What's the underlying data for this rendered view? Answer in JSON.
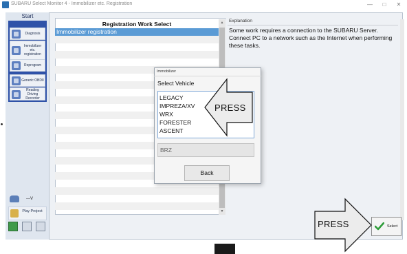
{
  "window": {
    "title": "SUBARU Select Monitor 4 - Immobilizer etc. Registration",
    "minimize": "—",
    "maximize": "□",
    "close": "✕"
  },
  "sidebar": {
    "start": "Start",
    "items": [
      {
        "label": "Diagnosis",
        "icon": "diagnosis-icon"
      },
      {
        "label": "Immobilizer etc. registration",
        "icon": "immobilizer-icon"
      },
      {
        "label": "Reprogram",
        "icon": "reprogram-icon"
      },
      {
        "label": "Generic OBDII",
        "icon": "generic-obd-icon"
      },
      {
        "label": "Reading Driving Recorder",
        "icon": "driving-recorder-icon"
      }
    ],
    "voltage": "---V",
    "play_project": "Play Project"
  },
  "registration": {
    "header": "Registration Work Select",
    "rows": [
      "Immobilizer registration"
    ]
  },
  "explanation": {
    "label": "Explanation",
    "text": "Some work requires a connection to the SUBARU Server. Connect PC to a network such as the Internet when performing these tasks."
  },
  "dialog": {
    "title": "Immobilizer",
    "heading": "Select Vehicle",
    "vehicles": [
      "LEGACY",
      "IMPREZA/XV",
      "WRX",
      "FORESTER",
      "ASCENT"
    ],
    "disabled_vehicle": "BRZ",
    "back_button": "Back"
  },
  "callouts": {
    "press_dialog": "PRESS",
    "press_select": "PRESS"
  },
  "select_button": {
    "label": "Select",
    "icon": "checkmark-icon"
  }
}
